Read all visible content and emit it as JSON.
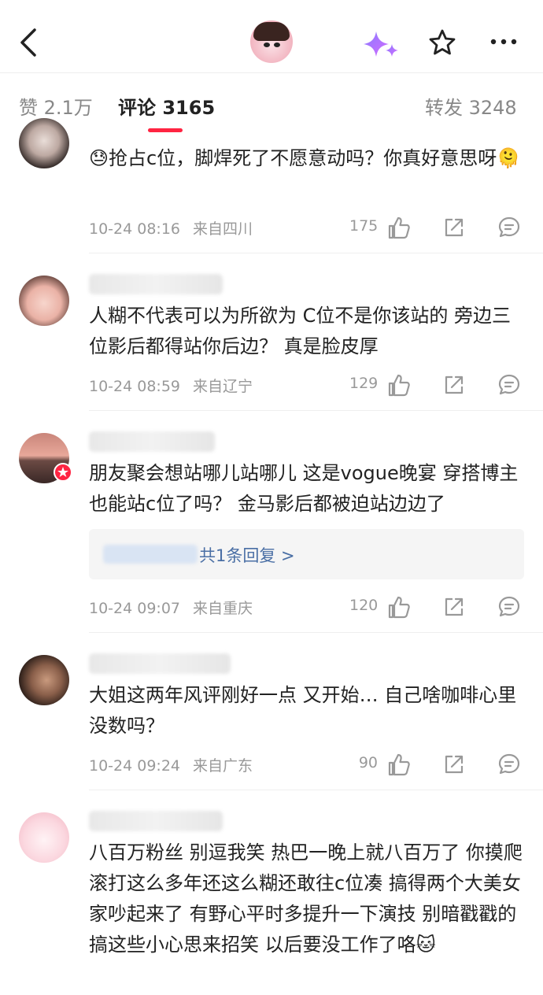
{
  "tabs": {
    "likes": "赞 2.1万",
    "comments": "评论 3165",
    "reposts": "转发 3248"
  },
  "icons": {
    "back": "back-arrow-icon",
    "ai": "sparkle-icon",
    "favorite": "star-icon",
    "more": "more-dots-icon",
    "like": "thumbs-up-icon",
    "share": "share-icon",
    "reply": "comment-icon"
  },
  "colors": {
    "accent": "#ff2442",
    "reply_link": "#4a6fa5"
  },
  "comments": [
    {
      "text": "😓抢占c位，脚焊死了不愿意动吗？你真好意思呀🫠",
      "date": "10-24 08:16",
      "location": "来自四川",
      "likes": "175"
    },
    {
      "text": "人糊不代表可以为所欲为 C位不是你该站的  旁边三位影后都得站你后边？   真是脸皮厚",
      "date": "10-24 08:59",
      "location": "来自辽宁",
      "likes": "129"
    },
    {
      "text": "朋友聚会想站哪儿站哪儿 这是vogue晚宴  穿搭博主也能站c位了吗？  金马影后都被迫站边边了",
      "reply_summary": "共1条回复 >",
      "date": "10-24 09:07",
      "location": "来自重庆",
      "likes": "120"
    },
    {
      "text": "大姐这两年风评刚好一点   又开始…   自己啥咖啡心里没数吗？",
      "date": "10-24 09:24",
      "location": "来自广东",
      "likes": "90"
    },
    {
      "text": "八百万粉丝 别逗我笑 热巴一晚上就八百万了 你摸爬滚打这么多年还这么糊还敢往c位凑 搞得两个大美女家吵起来了 有野心平时多提升一下演技 别暗戳戳的搞这些小心思来招笑 以后要没工作了咯🐱"
    }
  ]
}
